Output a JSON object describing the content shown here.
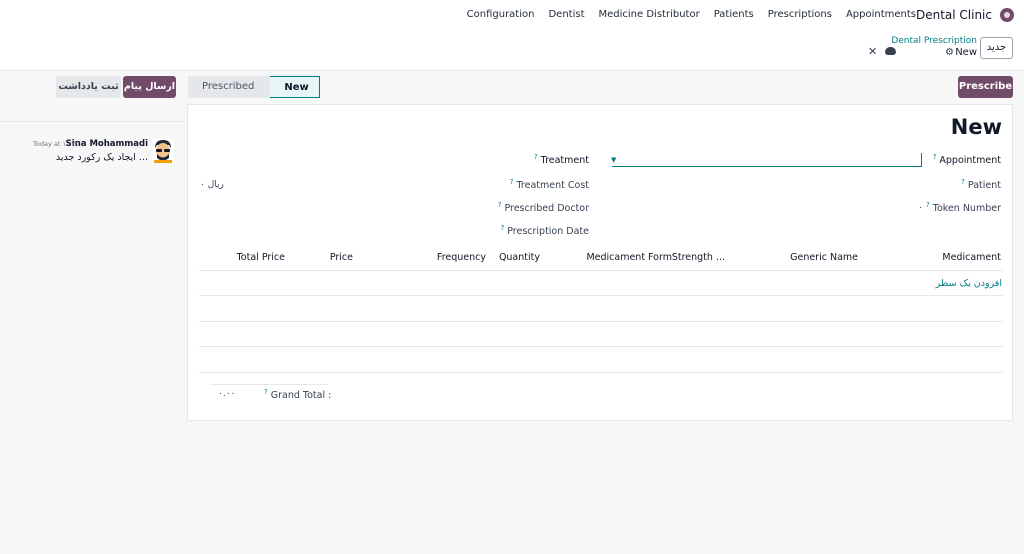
{
  "nav": {
    "app_name": "Dental Clinic",
    "menu": [
      "Appointments",
      "Prescriptions",
      "Patients",
      "Medicine Distributor",
      "Dentist",
      "Configuration"
    ]
  },
  "control": {
    "new_button": "جدید",
    "breadcrumb_parent": "Dental Prescription",
    "breadcrumb_current": "New"
  },
  "actions": {
    "prescribe": "Prescribe"
  },
  "status": {
    "stages": [
      "New",
      "Prescribed"
    ],
    "active": "New"
  },
  "form": {
    "title": "New",
    "fields_right": [
      {
        "label": "Appointment",
        "value": ""
      },
      {
        "label": "Patient",
        "value": ""
      },
      {
        "label": "Token Number",
        "value": "۰"
      }
    ],
    "fields_left": [
      {
        "label": "Treatment",
        "value": ""
      },
      {
        "label": "Treatment Cost",
        "value": "ریال ۰"
      },
      {
        "label": "Prescribed Doctor",
        "value": ""
      },
      {
        "label": "Prescription Date",
        "value": ""
      }
    ],
    "help_mark": "?"
  },
  "table": {
    "columns": [
      "Medicament",
      "Generic Name",
      "Strength ...",
      "Medicament Form",
      "Quantity",
      "Frequency",
      "Price",
      "Total Price"
    ],
    "add_line": "افزودن یک سطر",
    "grand_total_label": "Grand Total",
    "grand_total_value": "۰.۰۰"
  },
  "chatter": {
    "send_message": "ارسال پیام",
    "log_note": "ثبت یادداشت",
    "author": "Sina Mohammadi",
    "timestamp": "Today at ۱۰:۲۱",
    "message": "ایجاد یک رکورد جدید ..."
  },
  "colors": {
    "primary": "#714b67",
    "accent": "#017e84"
  }
}
